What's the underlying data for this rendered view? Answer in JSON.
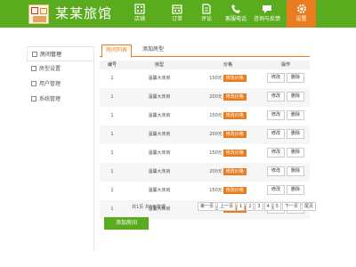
{
  "app": {
    "brand": "某某旅馆"
  },
  "nav": [
    {
      "label": "店铺",
      "icon": "building-icon"
    },
    {
      "label": "订单",
      "icon": "calendar-icon"
    },
    {
      "label": "评论",
      "icon": "document-icon"
    },
    {
      "label": "客服电话",
      "icon": "phone-icon"
    },
    {
      "label": "咨询与反馈",
      "icon": "chat-icon"
    },
    {
      "label": "设置",
      "icon": "gear-icon"
    }
  ],
  "colors": {
    "brand_green": "#5aac1e",
    "accent_orange": "#e97c1e"
  },
  "sidebar": {
    "items": [
      {
        "label": "房间管理"
      },
      {
        "label": "房型设置"
      },
      {
        "label": "用户管理"
      },
      {
        "label": "系统管理"
      }
    ]
  },
  "tabs": [
    {
      "label": "房间列表"
    },
    {
      "label": "添加房型"
    }
  ],
  "table": {
    "headers": [
      "编号",
      "房型",
      "价格",
      "操作"
    ],
    "rows": [
      {
        "id": "1",
        "type": "温馨大床房",
        "price": "150元",
        "tag": "修改价格",
        "edit": "修改",
        "delete": "删除"
      },
      {
        "id": "1",
        "type": "温馨大床房",
        "price": "200元",
        "tag": "修改价格",
        "edit": "修改",
        "delete": "删除"
      },
      {
        "id": "1",
        "type": "温馨大床房",
        "price": "150元",
        "tag": "修改价格",
        "edit": "修改",
        "delete": "删除"
      },
      {
        "id": "1",
        "type": "温馨大床房",
        "price": "200元",
        "tag": "修改价格",
        "edit": "修改",
        "delete": "删除"
      },
      {
        "id": "1",
        "type": "温馨大床房",
        "price": "150元",
        "tag": "修改价格",
        "edit": "修改",
        "delete": "删除"
      },
      {
        "id": "1",
        "type": "温馨大床房",
        "price": "200元",
        "tag": "修改价格",
        "edit": "修改",
        "delete": "删除"
      },
      {
        "id": "1",
        "type": "温馨大床房",
        "price": "150元",
        "tag": "修改价格",
        "edit": "修改",
        "delete": "删除"
      },
      {
        "id": "1",
        "type": "温馨大床房",
        "price": "200元",
        "tag": "修改价格",
        "edit": "修改",
        "delete": "删除"
      }
    ]
  },
  "pager": {
    "info": "共1页 共8条数据",
    "first": "第一页",
    "prev": "上一页",
    "pages": [
      "1",
      "2",
      "3",
      "4",
      "5"
    ],
    "next": "下一页",
    "last": "尾页"
  },
  "actions": {
    "submit_label": "添加房间"
  }
}
